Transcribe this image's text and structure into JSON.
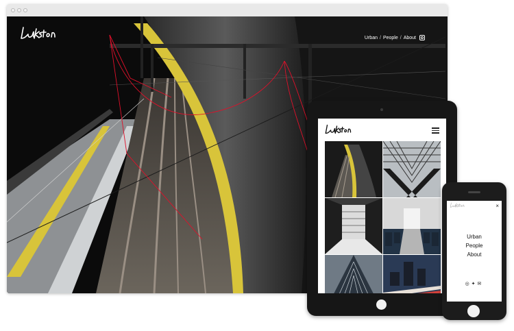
{
  "brand": {
    "logo_text": "Lukston"
  },
  "nav": {
    "items": [
      "Urban",
      "People",
      "About"
    ],
    "separator": "/",
    "social_icon": "instagram-icon"
  },
  "tablet": {
    "menu_icon": "hamburger-menu-icon",
    "gallery": [
      "train tunnel",
      "glass roof arches",
      "stairwell",
      "train interior",
      "glass building",
      "city traffic at night"
    ]
  },
  "phone": {
    "close_label": "×",
    "menu_items": [
      "Urban",
      "People",
      "About"
    ],
    "social_icons": [
      "instagram-icon",
      "twitter-icon",
      "mail-icon"
    ]
  },
  "colors": {
    "accent_yellow": "#d8c43a",
    "annotation_red": "#e0102a",
    "device_black": "#161616"
  }
}
